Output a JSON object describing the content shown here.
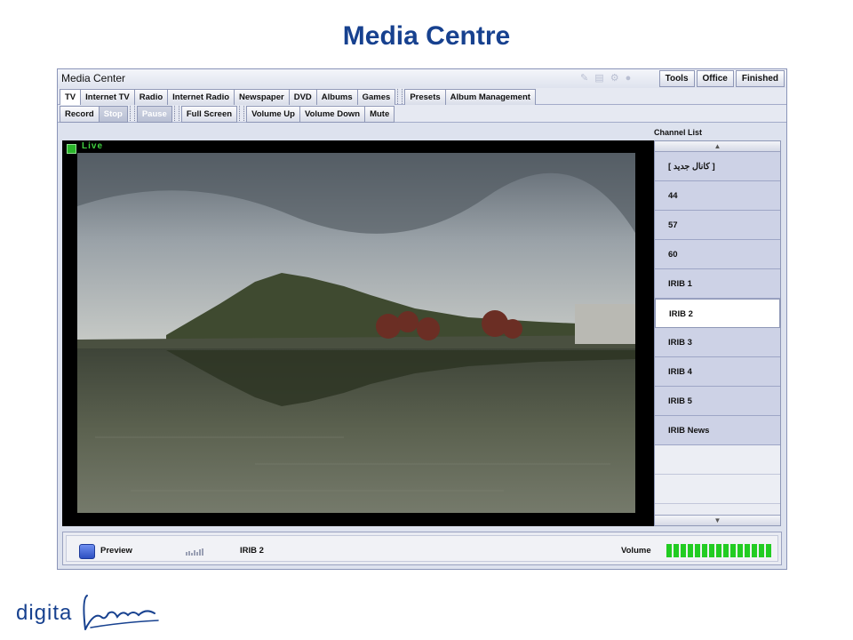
{
  "slide": {
    "title": "Media Centre"
  },
  "app": {
    "title": "Media Center",
    "top_buttons": [
      "Tools",
      "Office",
      "Finished"
    ],
    "tabs": [
      "TV",
      "Internet TV",
      "Radio",
      "Internet Radio",
      "Newspaper",
      "DVD",
      "Albums",
      "Games",
      "Presets",
      "Album Management"
    ],
    "active_tab": "TV",
    "controls": [
      "Record",
      "Stop",
      "Pause",
      "Full Screen",
      "Volume Up",
      "Volume Down",
      "Mute"
    ],
    "disabled_controls": [
      "Stop",
      "Pause"
    ]
  },
  "video": {
    "live_label": "Live"
  },
  "channel_list": {
    "title": "Channel List",
    "items": [
      "[ کانال جدید ]",
      "44",
      "57",
      "60",
      "IRIB 1",
      "IRIB 2",
      "IRIB 3",
      "IRIB 4",
      "IRIB 5",
      "IRIB News"
    ],
    "selected": "IRIB 2",
    "scroll_up_icon": "triangle-up-icon",
    "scroll_down_icon": "triangle-down-icon"
  },
  "statusbar": {
    "preview_label": "Preview",
    "channel": "IRIB 2",
    "volume_label": "Volume",
    "volume_level": 1.0,
    "volume_color": "#22cc22"
  },
  "footer": {
    "logo_text": "digital",
    "logo_script": "Clone"
  },
  "colors": {
    "title": "#17418f",
    "channel_item": "#cdd2e6",
    "live": "#2bb52b"
  }
}
